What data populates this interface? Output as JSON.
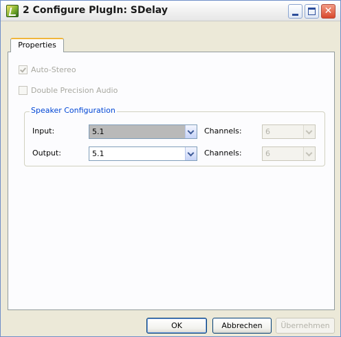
{
  "window": {
    "title": "2 Configure PlugIn: SDelay",
    "minimize_symbol": "",
    "maximize_symbol": "",
    "close_symbol": "✕"
  },
  "tabs": [
    {
      "label": "Properties",
      "active": true
    }
  ],
  "options": {
    "auto_stereo": {
      "label": "Auto-Stereo",
      "checked": true,
      "enabled": false
    },
    "double_precision": {
      "label": "Double Precision Audio",
      "checked": false,
      "enabled": false
    }
  },
  "speaker_config": {
    "title": "Speaker Configuration",
    "input": {
      "label": "Input:",
      "value": "5.1",
      "channels_label": "Channels:",
      "channels_value": "6"
    },
    "output": {
      "label": "Output:",
      "value": "5.1",
      "channels_label": "Channels:",
      "channels_value": "6"
    }
  },
  "buttons": {
    "ok": "OK",
    "cancel": "Abbrechen",
    "apply": "Übernehmen"
  },
  "colors": {
    "group_title": "#0046d5",
    "window_bg": "#ece9d8",
    "close_button": "#d8482c"
  }
}
